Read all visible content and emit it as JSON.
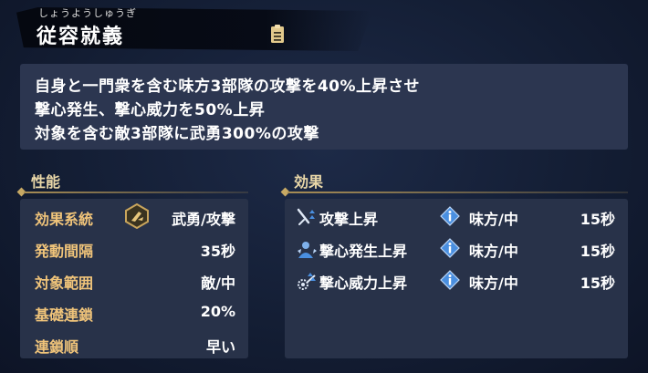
{
  "skill": {
    "ruby": "しょうようしゅうぎ",
    "name": "従容就義"
  },
  "description": {
    "lines": [
      "自身と一門衆を含む味方3部隊の攻撃を40%上昇させ",
      "撃心発生、撃心威力を50%上昇",
      "対象を含む敵3部隊に武勇300%の攻撃"
    ]
  },
  "stats": {
    "header": "性能",
    "rows": [
      {
        "label": "効果系統",
        "value": "武勇/攻撃"
      },
      {
        "label": "発動間隔",
        "value": "35秒"
      },
      {
        "label": "対象範囲",
        "value": "敵/中"
      },
      {
        "label": "基礎連鎖",
        "value": "20%"
      },
      {
        "label": "連鎖順",
        "value": "早い"
      }
    ]
  },
  "effects": {
    "header": "効果",
    "rows": [
      {
        "icon": "attack-up-icon",
        "name": "攻撃上昇",
        "target": "味方/中",
        "duration": "15秒"
      },
      {
        "icon": "crit-rate-up-icon",
        "name": "撃心発生上昇",
        "target": "味方/中",
        "duration": "15秒"
      },
      {
        "icon": "crit-damage-up-icon",
        "name": "撃心威力上昇",
        "target": "味方/中",
        "duration": "15秒"
      }
    ]
  },
  "colors": {
    "stat_label": "#f0c47a",
    "section_header": "#e9d7a8",
    "panel_bg": "#283249",
    "desc_bg": "#2c3650",
    "accent_blue": "#4a8fe0"
  }
}
